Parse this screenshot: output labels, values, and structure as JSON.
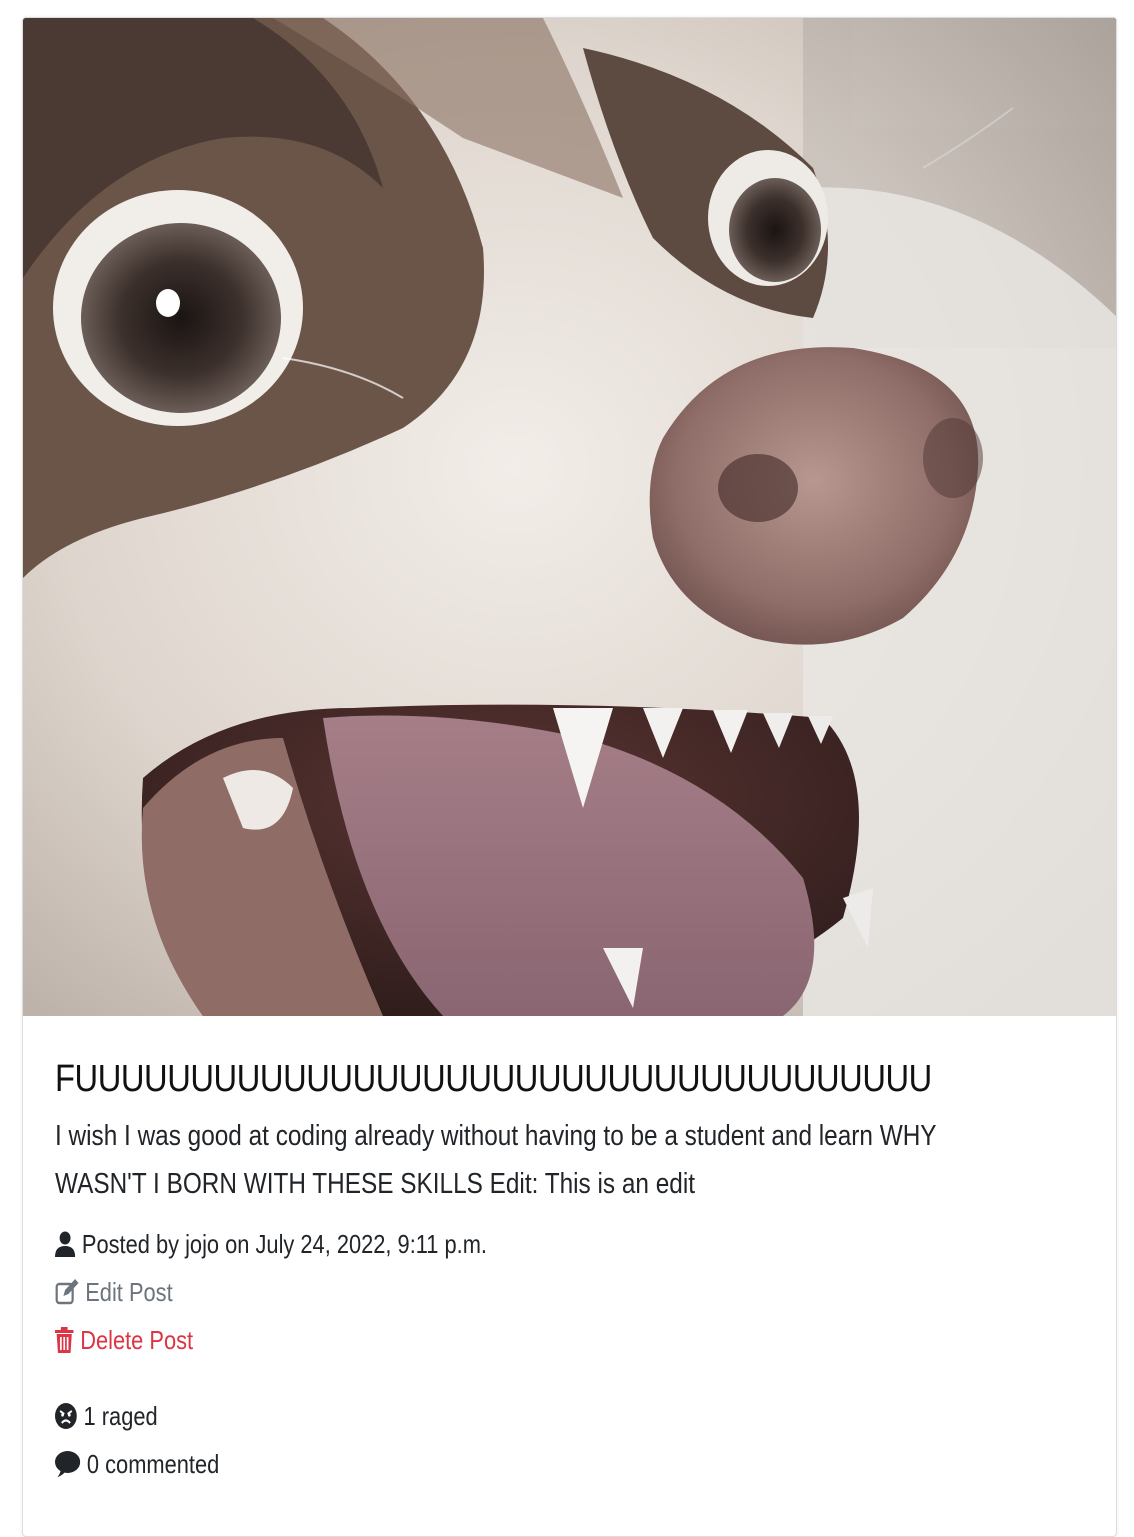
{
  "post": {
    "title": "FUUUUUUUUUUUUUUUUUUUUUUUUUUUUUUUUUUUUU",
    "content": "I wish I was good at coding already without having to be a student and learn WHY WASN'T I BORN WITH THESE SKILLS Edit: This is an edit",
    "author_line": "Posted by jojo on July 24, 2022, 9:11 p.m.",
    "edit_label": "Edit Post",
    "delete_label": "Delete Post",
    "rage_count": "1 raged",
    "comment_count": "0 commented"
  },
  "icons": {
    "author": "user-icon",
    "edit": "edit-icon",
    "delete": "trash-icon",
    "rage": "angry-face-icon",
    "comment": "comment-icon"
  },
  "colors": {
    "text": "#212529",
    "muted": "#6c757d",
    "danger": "#dc3545"
  }
}
